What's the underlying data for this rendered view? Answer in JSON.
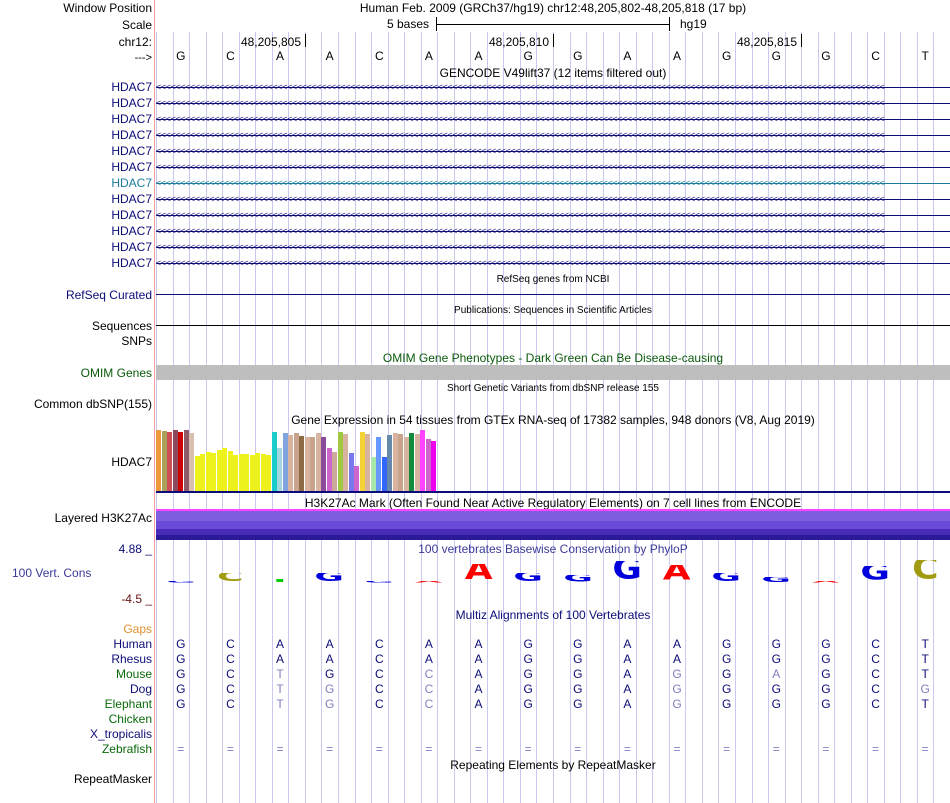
{
  "header": {
    "window_position_label": "Window Position",
    "assembly_position": "Human Feb. 2009 (GRCh37/hg19)   chr12:48,205,802-48,205,818 (17 bp)",
    "scale_label": "Scale",
    "scale_bar_text": "5 bases",
    "scale_db": "hg19",
    "chrom_label": "chr12:",
    "coord_ticks": [
      "48,205,805",
      "48,205,810",
      "48,205,815"
    ],
    "strand_label": "--->",
    "bases": [
      "G",
      "C",
      "A",
      "A",
      "C",
      "A",
      "A",
      "G",
      "G",
      "A",
      "A",
      "G",
      "G",
      "G",
      "C",
      "T"
    ]
  },
  "gencode": {
    "title": "GENCODE V49lift37 (12 items filtered out)",
    "items": [
      "HDAC7",
      "HDAC7",
      "HDAC7",
      "HDAC7",
      "HDAC7",
      "HDAC7",
      "HDAC7",
      "HDAC7",
      "HDAC7",
      "HDAC7",
      "HDAC7",
      "HDAC7"
    ],
    "strand_glyph": "<",
    "colors": [
      "#0c0c78",
      "#0c0c78",
      "#0c0c78",
      "#0c0c78",
      "#0c0c78",
      "#0c0c78",
      "#1a7c9c",
      "#0c0c78",
      "#0c0c78",
      "#0c0c78",
      "#0c0c78",
      "#0c0c78"
    ]
  },
  "refseq": {
    "title": "RefSeq genes from NCBI",
    "label": "RefSeq Curated",
    "color": "#0c0c78"
  },
  "publications": {
    "title": "Publications: Sequences in Scientific Articles",
    "label": "Sequences"
  },
  "snps": {
    "label": "SNPs"
  },
  "omim": {
    "title": "OMIM Gene Phenotypes - Dark Green Can Be Disease-causing",
    "label": "OMIM Genes",
    "color": "#0a5a0a"
  },
  "dbsnp": {
    "title": "Short Genetic Variants from dbSNP release 155",
    "label": "Common dbSNP(155)"
  },
  "gtex": {
    "title": "Gene Expression in 54 tissues from GTEx RNA-seq of 17382 samples, 948 donors (V8, Aug 2019)",
    "label": "HDAC7",
    "bar_values": [
      0.97,
      0.95,
      0.93,
      0.97,
      0.94,
      0.97,
      0.92,
      0.56,
      0.59,
      0.62,
      0.6,
      0.65,
      0.69,
      0.63,
      0.57,
      0.59,
      0.59,
      0.57,
      0.6,
      0.58,
      0.57,
      0.93,
      0.68,
      0.92,
      0.89,
      0.92,
      0.88,
      0.85,
      0.86,
      0.92,
      0.86,
      0.68,
      0.62,
      0.93,
      0.9,
      0.6,
      0.4,
      0.94,
      0.9,
      0.54,
      0.86,
      0.54,
      0.89,
      0.92,
      0.91,
      0.86,
      0.92,
      0.91,
      0.97,
      0.82,
      0.8
    ],
    "bar_colors": [
      "#ee9a3c",
      "#a9a05a",
      "#cf4f58",
      "#8b4b5c",
      "#cc0404",
      "#8f5a67",
      "#d9bfad",
      "#eef21c",
      "#eef21c",
      "#eef21c",
      "#eef21c",
      "#eef21c",
      "#eef21c",
      "#eef21c",
      "#eef21c",
      "#eef21c",
      "#eef21c",
      "#eef21c",
      "#eef21c",
      "#eef21c",
      "#eef21c",
      "#18cccc",
      "#a6d6e0",
      "#7fa4e0",
      "#d8b4a0",
      "#c8a48c",
      "#8e6b45",
      "#d8b4a0",
      "#c8a48c",
      "#d8b4a0",
      "#8b4b9c",
      "#cc66cc",
      "#ccaa99",
      "#a0c840",
      "#d8b4a0",
      "#7777ee",
      "#cc66cc",
      "#f4d434",
      "#d8b4a0",
      "#aae8aa",
      "#6699ff",
      "#3366ff",
      "#6688aa",
      "#d8b4a0",
      "#c8a48c",
      "#d8b4a0",
      "#138b3c",
      "#d8b4a0",
      "#ff44ff",
      "#cc66cc",
      "#ee00ee"
    ]
  },
  "h3k27ac": {
    "title": "H3K27Ac Mark (Often Found Near Active Regulatory Elements) on 7 cell lines from ENCODE",
    "label": "Layered H3K27Ac"
  },
  "phylop": {
    "title": "100 vertebrates Basewise Conservation by PhyloP",
    "label": "100 Vert. Cons",
    "ymax": "4.88 _",
    "ymin": "-4.5 _",
    "letters": [
      {
        "base": "G",
        "score": 0.1
      },
      {
        "base": "C",
        "score": 0.8
      },
      {
        "base": "T",
        "score": 0.35
      },
      {
        "base": "G",
        "score": 0.8
      },
      {
        "base": "G",
        "score": 0.05
      },
      {
        "base": "A",
        "score": 0.05
      },
      {
        "base": "A",
        "score": 1.6
      },
      {
        "base": "G",
        "score": 0.8
      },
      {
        "base": "G",
        "score": 0.7
      },
      {
        "base": "G",
        "score": 1.8
      },
      {
        "base": "A",
        "score": 1.5
      },
      {
        "base": "G",
        "score": 0.8
      },
      {
        "base": "G",
        "score": 0.5
      },
      {
        "base": "A",
        "score": 0.05
      },
      {
        "base": "G",
        "score": 1.4
      },
      {
        "base": "C",
        "score": 1.9
      }
    ]
  },
  "multiz": {
    "title": "Multiz Alignments of 100 Vertebrates",
    "gaps_label": "Gaps",
    "species": [
      {
        "name": "Human",
        "seq": "GCAACAAGGAAGGGCT",
        "faint": "",
        "color": "#0c0c78"
      },
      {
        "name": "Rhesus",
        "seq": "GCAACAAGGAAGGGCT",
        "faint": "",
        "color": "#0c0c78"
      },
      {
        "name": "Mouse",
        "seq": "GCTGCCAGGAGGAGCT",
        "faint": "0010010000101000",
        "color": "#0a6a0a"
      },
      {
        "name": "Dog",
        "seq": "GCTGCCAGGAGGGGCG",
        "faint": "0011010000100001",
        "color": "#0c0c78"
      },
      {
        "name": "Elephant",
        "seq": "GCTGCCAGGAGGGGCT",
        "faint": "0011010000100000",
        "color": "#0a6a0a"
      },
      {
        "name": "Chicken",
        "seq": "",
        "faint": "",
        "color": "#0a6a0a"
      },
      {
        "name": "X_tropicalis",
        "seq": "",
        "faint": "",
        "color": "#0c0c78"
      },
      {
        "name": "Zebrafish",
        "seq": "================",
        "faint": "1111111111111111",
        "color": "#0a6a0a"
      }
    ]
  },
  "repeatmasker": {
    "title": "Repeating Elements by RepeatMasker",
    "label": "RepeatMasker"
  },
  "colors": {
    "gene_blue": "#0c0c78",
    "omim_gray": "#bebebe",
    "grid_blue": "#c8c8f0",
    "left_rule": "#f0a0a0"
  }
}
